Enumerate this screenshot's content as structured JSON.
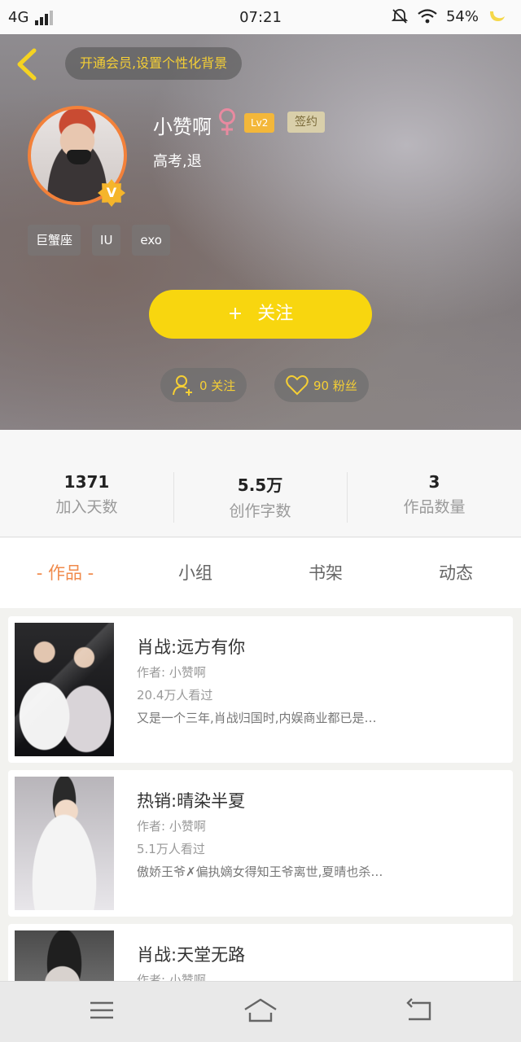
{
  "status_bar": {
    "network": "4G",
    "time": "07:21",
    "battery": "54%"
  },
  "header": {
    "vip_banner": "开通会员,设置个性化背景",
    "username": "小赞啊",
    "level": "Lv2",
    "sign_badge": "签约",
    "bio": "高考,退",
    "vip_badge": "V",
    "tags": [
      "巨蟹座",
      "IU",
      "exo"
    ],
    "follow_button": {
      "icon": "+",
      "label": "关注"
    },
    "following": "0 关注",
    "fans": "90 粉丝"
  },
  "stats": [
    {
      "value": "1371",
      "label": "加入天数"
    },
    {
      "value": "5.5万",
      "label": "创作字数"
    },
    {
      "value": "3",
      "label": "作品数量"
    }
  ],
  "tabs": [
    {
      "label": "- 作品 -",
      "active": true
    },
    {
      "label": "小组",
      "active": false
    },
    {
      "label": "书架",
      "active": false
    },
    {
      "label": "动态",
      "active": false
    }
  ],
  "works": [
    {
      "title": "肖战:远方有你",
      "author": "作者: 小赞啊",
      "views": "20.4万人看过",
      "desc": "又是一个三年,肖战归国时,内娱商业都已是…"
    },
    {
      "title": "热销:晴染半夏",
      "author": "作者: 小赞啊",
      "views": "5.1万人看过",
      "desc": "傲娇王爷✗偏执嫡女得知王爷离世,夏晴也杀…"
    },
    {
      "title": "肖战:天堂无路",
      "author": "作者: 小赞啊",
      "views": "",
      "desc": ""
    }
  ],
  "colors": {
    "accent_yellow": "#f8d60f",
    "tab_active": "#f08a4b",
    "avatar_ring": "#f3813a"
  },
  "icons": {
    "back": "chevron-left-icon",
    "female": "female-icon",
    "following": "person-add-icon",
    "fans": "heart-icon",
    "nav_menu": "menu-icon",
    "nav_home": "home-icon",
    "nav_back": "back-icon"
  }
}
